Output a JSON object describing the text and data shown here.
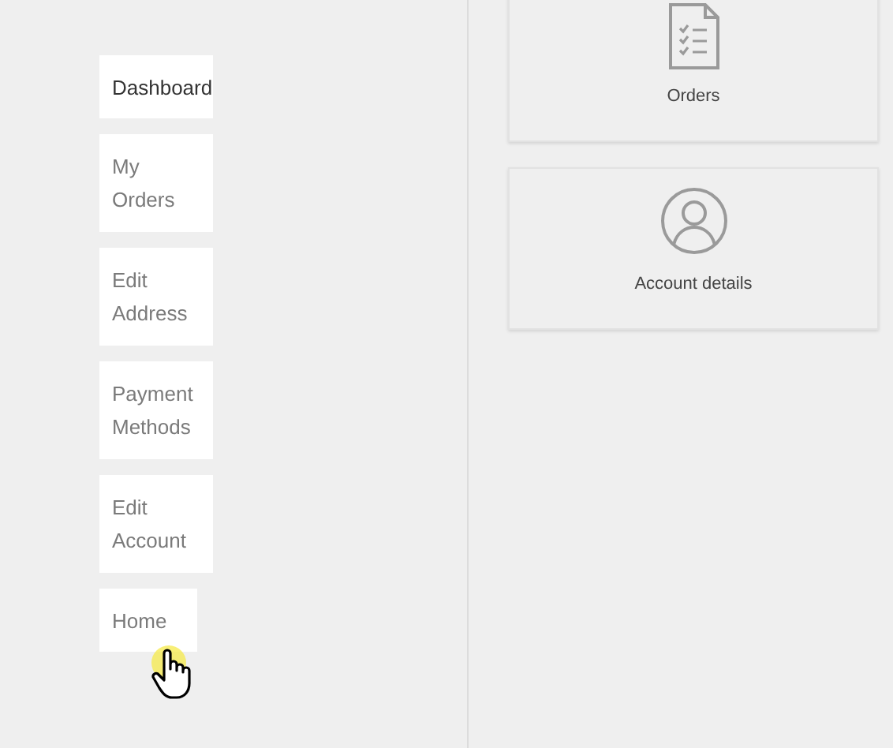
{
  "sidebar": {
    "items": [
      {
        "label": "Dashboard",
        "selected": true
      },
      {
        "label": "My Orders",
        "selected": false
      },
      {
        "label": "Edit Address",
        "selected": false
      },
      {
        "label": "Payment Methods",
        "selected": false
      },
      {
        "label": "Edit Account",
        "selected": false
      },
      {
        "label": "Home",
        "selected": false
      }
    ]
  },
  "cards": [
    {
      "kind": "orders",
      "label": "Orders"
    },
    {
      "kind": "account",
      "label": "Account details"
    }
  ]
}
